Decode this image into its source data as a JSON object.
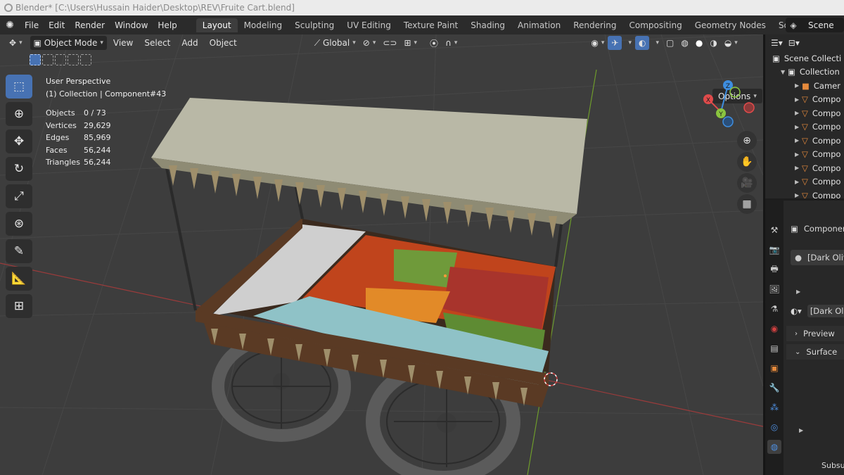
{
  "title": "Blender* [C:\\Users\\Hussain Haider\\Desktop\\REV\\Fruite Cart.blend]",
  "menu": [
    "File",
    "Edit",
    "Render",
    "Window",
    "Help"
  ],
  "workspaces": [
    "Layout",
    "Modeling",
    "Sculpting",
    "UV Editing",
    "Texture Paint",
    "Shading",
    "Animation",
    "Rendering",
    "Compositing",
    "Geometry Nodes",
    "Scripting"
  ],
  "active_workspace": "Layout",
  "scene": "Scene",
  "viewport": {
    "mode": "Object Mode",
    "header_menus": [
      "View",
      "Select",
      "Add",
      "Object"
    ],
    "orientation": "Global",
    "options": "Options",
    "perspective": "User Perspective",
    "collection_line": "(1) Collection | Component#43",
    "stats": [
      {
        "k": "Objects",
        "v": "0 / 73"
      },
      {
        "k": "Vertices",
        "v": "29,629"
      },
      {
        "k": "Edges",
        "v": "85,969"
      },
      {
        "k": "Faces",
        "v": "56,244"
      },
      {
        "k": "Triangles",
        "v": "56,244"
      }
    ],
    "gizmo": {
      "x": "X",
      "y": "Y",
      "z": "Z"
    }
  },
  "outliner": {
    "rows": [
      {
        "label": "Scene Collecti",
        "type": "scene"
      },
      {
        "label": "Collection",
        "type": "collection"
      },
      {
        "label": "Camer",
        "type": "camera"
      },
      {
        "label": "Compo",
        "type": "mesh"
      },
      {
        "label": "Compo",
        "type": "mesh"
      },
      {
        "label": "Compo",
        "type": "mesh"
      },
      {
        "label": "Compo",
        "type": "mesh"
      },
      {
        "label": "Compo",
        "type": "mesh"
      },
      {
        "label": "Compo",
        "type": "mesh"
      },
      {
        "label": "Compo",
        "type": "mesh"
      },
      {
        "label": "Compo",
        "type": "mesh"
      }
    ]
  },
  "properties": {
    "object_name": "Componen",
    "material": "[Dark Oliv",
    "material_2": "[Dark Ol",
    "sections": [
      "Preview",
      "Surface"
    ],
    "subsurface": "Subsu"
  },
  "colors": {
    "accent": "#4772b3",
    "bg": "#3d3d3d",
    "panel": "#282828",
    "axis_x": "#e04b4b",
    "axis_y": "#8ac43f",
    "axis_z": "#3e8ee0"
  }
}
